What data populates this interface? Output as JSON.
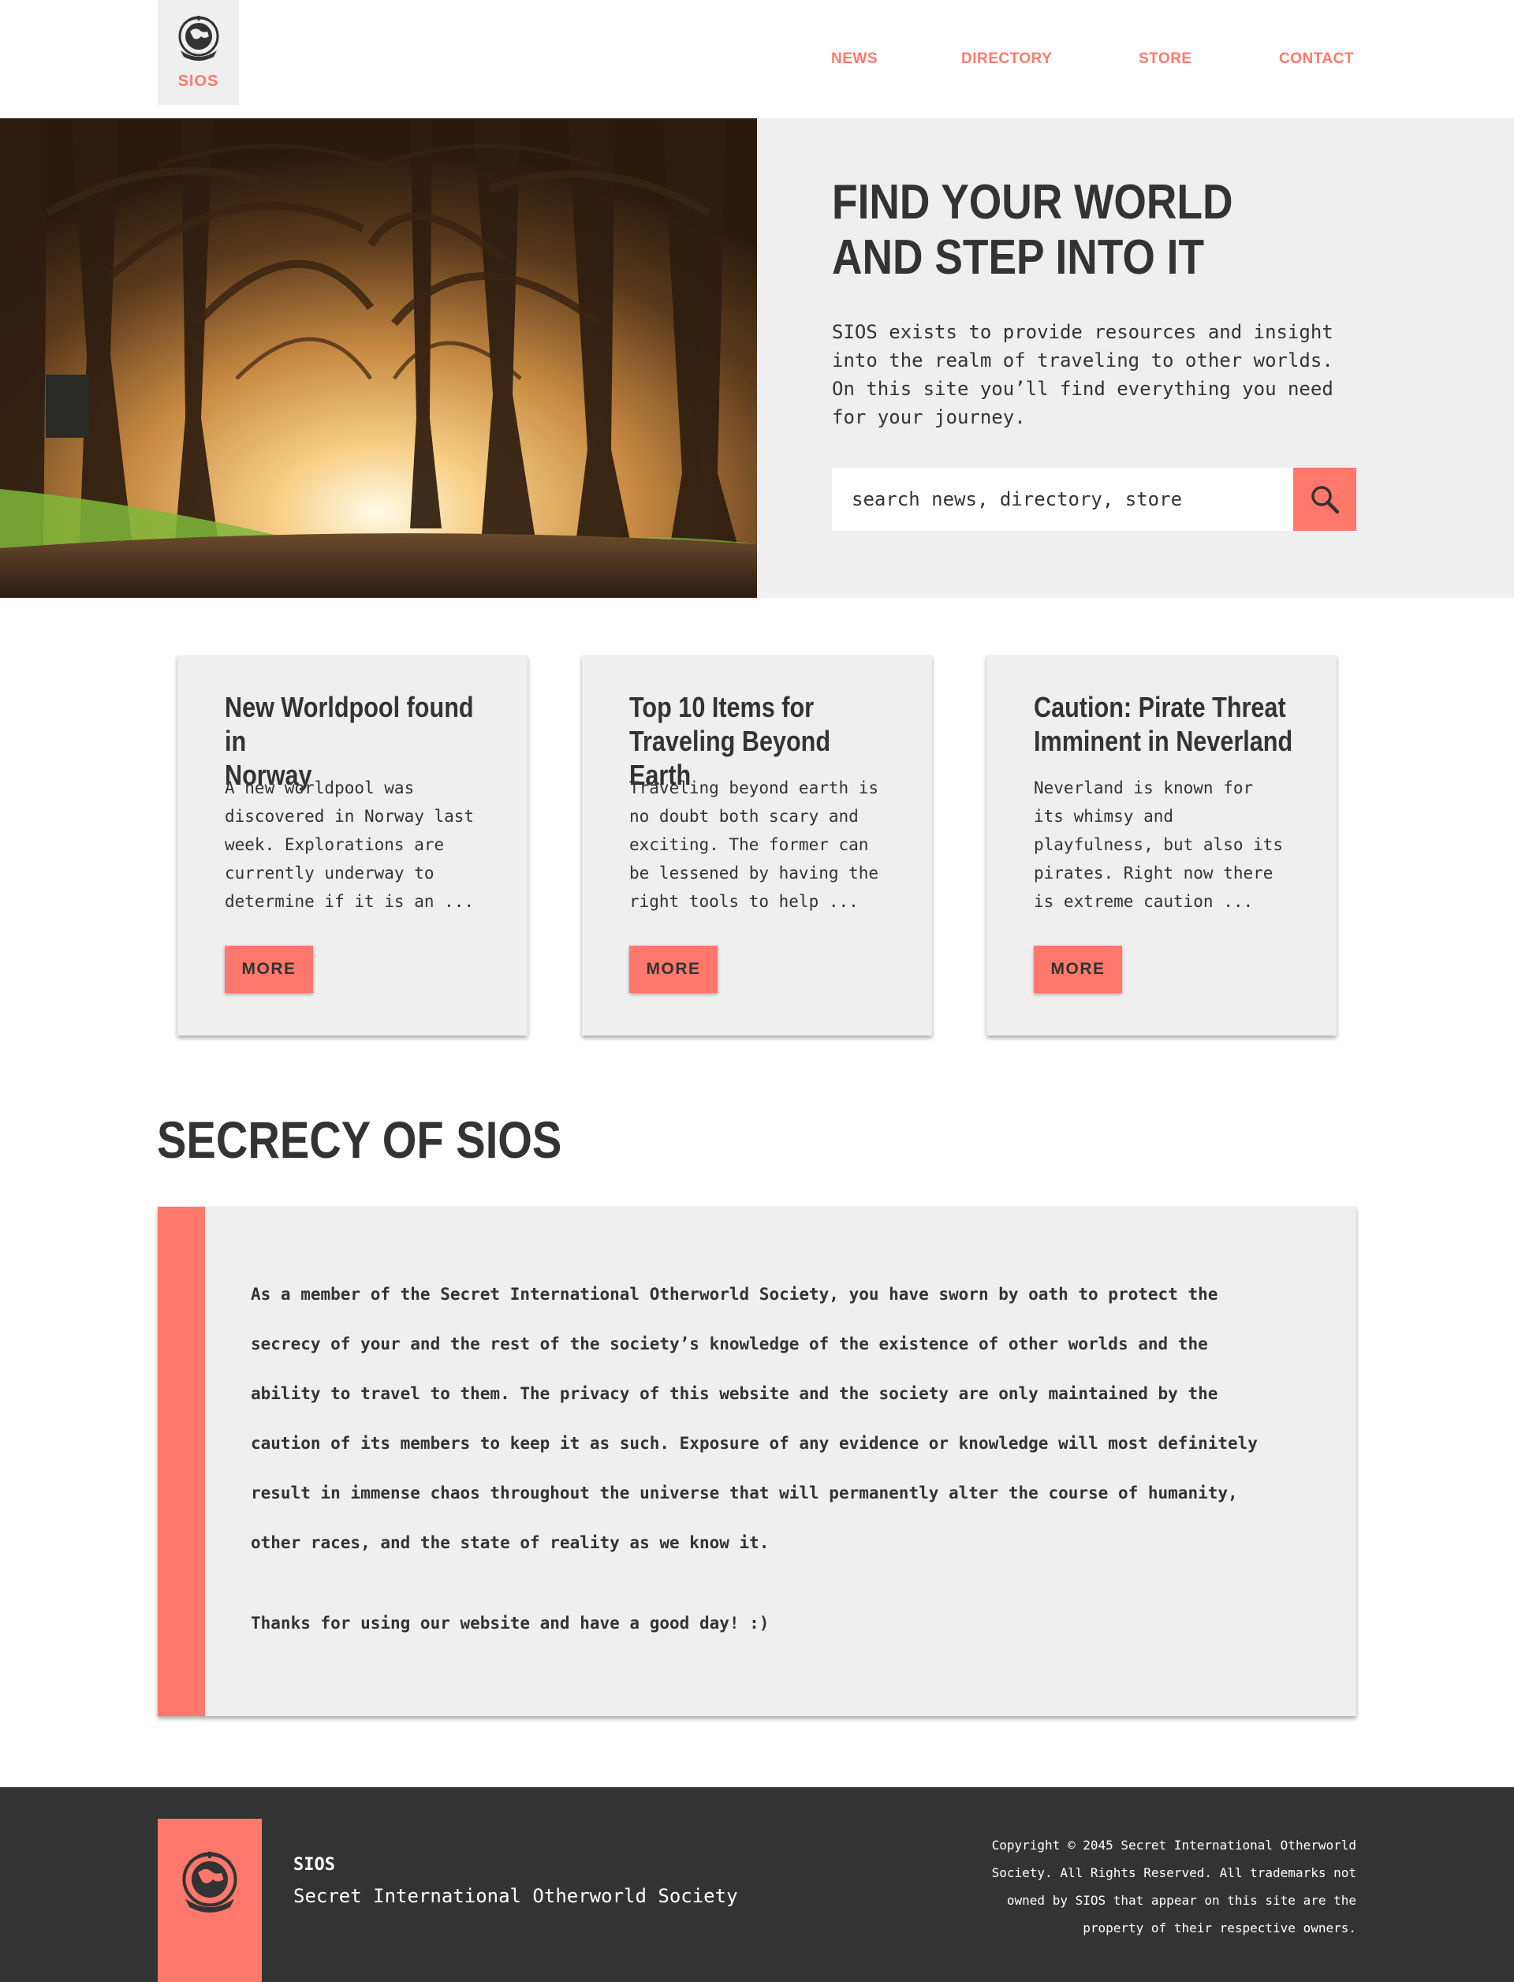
{
  "header": {
    "logo_text": "SIOS",
    "nav": [
      "NEWS",
      "DIRECTORY",
      "STORE",
      "CONTACT"
    ]
  },
  "hero": {
    "title_lines": [
      "FIND YOUR WORLD",
      "AND STEP INTO IT"
    ],
    "description": "SIOS exists to provide resources and insight into the realm of traveling to other worlds. On this site you’ll find everything you need for your journey.",
    "search_placeholder": "search news, directory, store",
    "search_icon": "magnifier-icon",
    "image": "forest-tree-tunnel-photo"
  },
  "cards": [
    {
      "title_lines": [
        "New Worldpool found in",
        "Norway"
      ],
      "text_lines": [
        "A new worldpool was",
        "discovered in Norway last",
        "week. Explorations are",
        "currently underway to",
        "determine if it is an ..."
      ],
      "button": "MORE"
    },
    {
      "title_lines": [
        "Top 10 Items for",
        "Traveling Beyond Earth"
      ],
      "text_lines": [
        "Traveling beyond earth is",
        "no doubt both scary and",
        "exciting. The former can",
        "be lessened by having the",
        "right tools to help ..."
      ],
      "button": "MORE"
    },
    {
      "title_lines": [
        "Caution: Pirate Threat",
        "Imminent in Neverland"
      ],
      "text_lines": [
        "Neverland is known for",
        "its whimsy and",
        "playfulness, but also its",
        "pirates. Right now there",
        "is extreme caution ..."
      ],
      "button": "MORE"
    }
  ],
  "secrecy": {
    "title": "SECRECY OF SIOS",
    "lines": [
      "As a member of the Secret International Otherworld Society, you have sworn by oath to protect the",
      "secrecy of your and the rest of the society’s knowledge of the existence of other worlds and the",
      "ability to travel to them. The privacy of this website and the society are only maintained by the",
      "caution of its members to keep it as such. Exposure of any evidence or knowledge will most definitely",
      "result in immense chaos throughout the universe that will permanently alter the course of humanity,",
      "other races, and the state of reality as we know it."
    ],
    "thanks": "Thanks for using our website and have a good day! :)"
  },
  "footer": {
    "brand": "SIOS",
    "subtitle": "Secret International Otherworld Society",
    "copyright_lines": [
      "Copyright © 2045 Secret International Otherworld",
      "Society. All Rights Reserved. All trademarks not",
      "owned by SIOS that appear on this site are the",
      "property of their respective owners."
    ]
  },
  "colors": {
    "accent": "#ff786b",
    "text": "#333333",
    "panel": "#efefef",
    "footer": "#333333"
  }
}
